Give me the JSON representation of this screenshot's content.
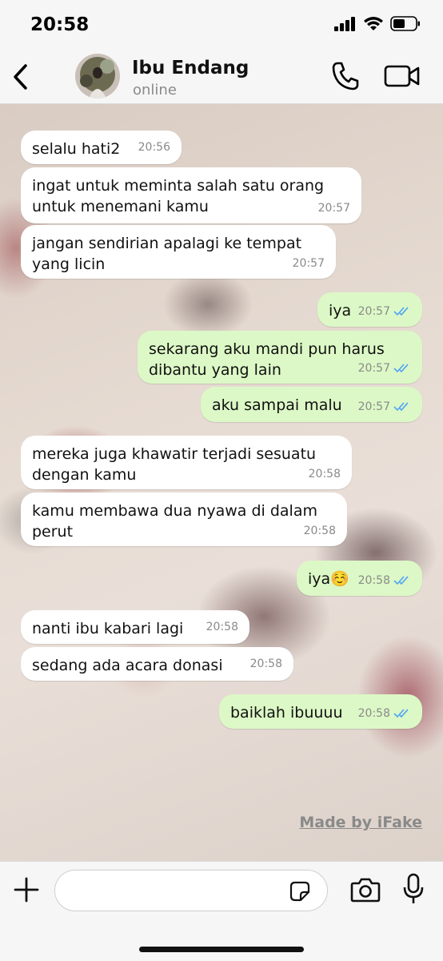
{
  "status_bar": {
    "time": "20:58"
  },
  "header": {
    "contact_name": "Ibu Endang",
    "contact_status": "online"
  },
  "messages": [
    {
      "dir": "in",
      "text": "selalu hati2",
      "time": "20:56"
    },
    {
      "dir": "in",
      "text": "ingat untuk meminta salah satu orang untuk menemani kamu",
      "time": "20:57"
    },
    {
      "dir": "in",
      "text": "jangan sendirian apalagi ke tempat yang licin",
      "time": "20:57"
    },
    {
      "dir": "out",
      "text": "iya",
      "time": "20:57",
      "read": true
    },
    {
      "dir": "out",
      "text": "sekarang aku mandi pun harus dibantu yang lain",
      "time": "20:57",
      "read": true
    },
    {
      "dir": "out",
      "text": "aku sampai malu",
      "time": "20:57",
      "read": true
    },
    {
      "dir": "in",
      "text": "mereka juga khawatir terjadi sesuatu dengan kamu",
      "time": "20:58"
    },
    {
      "dir": "in",
      "text": "kamu membawa dua nyawa di dalam perut",
      "time": "20:58"
    },
    {
      "dir": "out",
      "text": "iya☺️",
      "time": "20:58",
      "read": true
    },
    {
      "dir": "in",
      "text": "nanti ibu kabari lagi",
      "time": "20:58"
    },
    {
      "dir": "in",
      "text": "sedang ada acara donasi",
      "time": "20:58"
    },
    {
      "dir": "out",
      "text": "baiklah ibuuuu",
      "time": "20:58",
      "read": true
    }
  ],
  "watermark": "Made by iFake",
  "input": {
    "value": "",
    "placeholder": ""
  },
  "colors": {
    "outgoing_bubble": "#dcf8c6",
    "incoming_bubble": "#ffffff",
    "read_tick": "#4fa3f7"
  },
  "icons": [
    "back-chevron-icon",
    "phone-icon",
    "video-camera-icon",
    "plus-icon",
    "sticker-icon",
    "camera-icon",
    "microphone-icon",
    "signal-icon",
    "wifi-icon",
    "battery-icon"
  ]
}
